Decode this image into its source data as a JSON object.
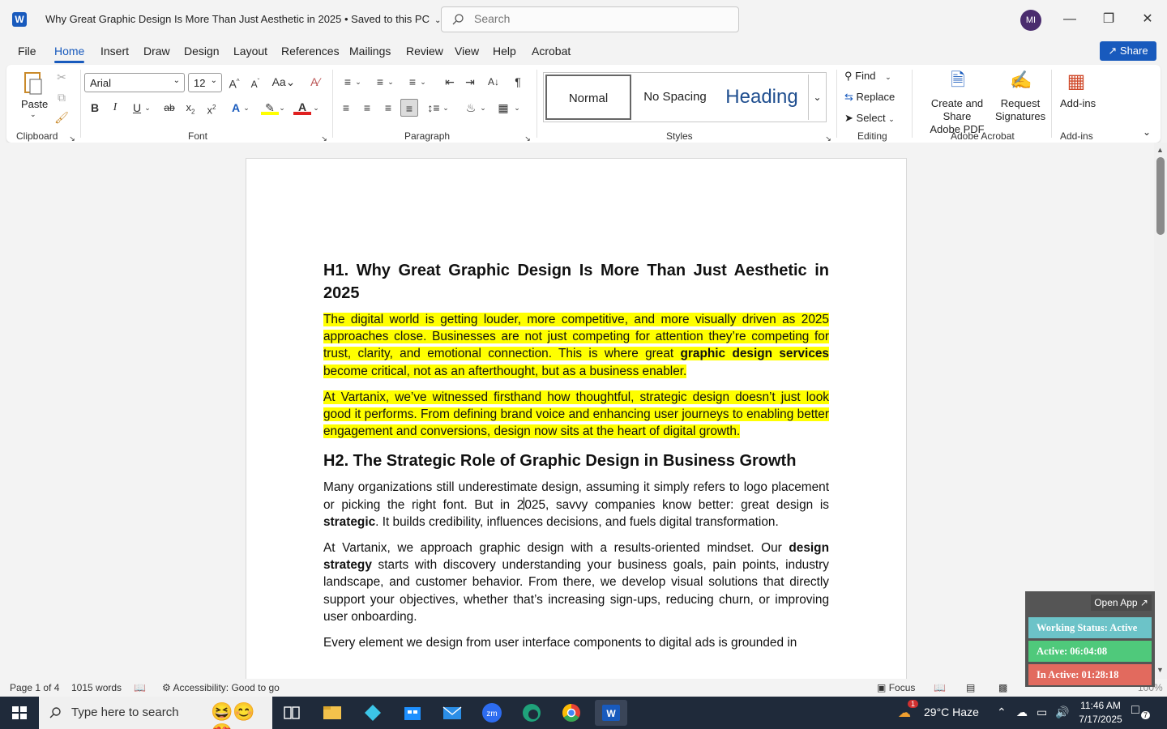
{
  "window": {
    "app_icon": "W",
    "title": "Why Great Graphic Design Is More Than Just Aesthetic in 2025 • Saved to this PC",
    "search_placeholder": "Search",
    "avatar_initials": "MI"
  },
  "menu": {
    "tabs": [
      "File",
      "Home",
      "Insert",
      "Draw",
      "Design",
      "Layout",
      "References",
      "Mailings",
      "Review",
      "View",
      "Help",
      "Acrobat"
    ],
    "active_tab": "Home",
    "share_label": "Share"
  },
  "ribbon": {
    "clipboard": {
      "paste_label": "Paste",
      "group_label": "Clipboard"
    },
    "font": {
      "family": "Arial",
      "size": "12",
      "group_label": "Font"
    },
    "paragraph": {
      "group_label": "Paragraph"
    },
    "styles": {
      "items": [
        "Normal",
        "No Spacing",
        "Heading"
      ],
      "selected": "Normal",
      "group_label": "Styles"
    },
    "editing": {
      "find": "Find",
      "replace": "Replace",
      "select": "Select",
      "group_label": "Editing"
    },
    "acrobat": {
      "create_share_line1": "Create and Share",
      "create_share_line2": "Adobe PDF",
      "request_line1": "Request",
      "request_line2": "Signatures",
      "group_label": "Adobe Acrobat"
    },
    "addins": {
      "label": "Add-ins",
      "group_label": "Add-ins"
    }
  },
  "document": {
    "h1": "H1. Why Great Graphic Design Is More Than Just Aesthetic in 2025",
    "p1_a": "The digital world is getting louder, more competitive, and more visually driven as 2025 approaches close. Businesses are not just competing for attention they’re competing for trust, clarity, and emotional connection. This is where great ",
    "p1_bold": "graphic design services",
    "p1_b": " become critical, not as an afterthought, but as a business enabler.",
    "p2": "At Vartanix, we’ve witnessed firsthand how thoughtful, strategic design doesn’t just look good it performs. From defining brand voice and enhancing user journeys to enabling better engagement and conversions, design now sits at the heart of digital growth.",
    "h2": "H2. The Strategic Role of Graphic Design in Business Growth",
    "p3_a": "Many organizations still underestimate design, assuming it simply refers to logo placement or picking the right font. But in 2",
    "p3_b": "025, savvy companies know better: great design is ",
    "p3_bold": "strategic",
    "p3_c": ". It builds credibility, influences decisions, and fuels digital transformation.",
    "p4_a": "At Vartanix, we approach graphic design with a results-oriented mindset. Our ",
    "p4_bold": "design strategy",
    "p4_b": " starts with discovery understanding your business goals, pain points, industry landscape, and customer behavior. From there, we develop visual solutions that directly support your objectives, whether that’s increasing sign-ups, reducing churn, or improving user onboarding.",
    "p5": "Every element we design from user interface components to digital ads is grounded in"
  },
  "status": {
    "page": "Page 1 of 4",
    "words": "1015 words",
    "accessibility": "Accessibility: Good to go",
    "focus": "Focus",
    "zoom": "100%"
  },
  "tracker": {
    "open_app": "Open App ↗",
    "working_status": "Working Status: Active",
    "active": "Active: 06:04:08",
    "inactive": "In Active: 01:28:18",
    "colors": {
      "working": "#6cc3c8",
      "active": "#4fc97b",
      "inactive": "#e26a5e"
    }
  },
  "taskbar": {
    "search_placeholder": "Type here to search",
    "weather": "29°C  Haze",
    "weather_badge": "1",
    "time": "11:46 AM",
    "date": "7/17/2025",
    "notification_count": "7"
  },
  "colors": {
    "accent": "#185abd",
    "highlight": "#ffff00"
  }
}
